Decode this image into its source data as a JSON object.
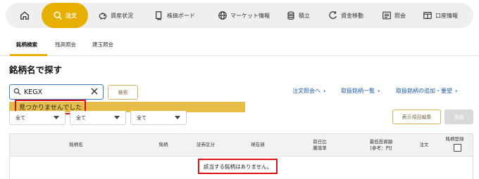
{
  "nav": {
    "items": [
      {
        "icon": "home-icon",
        "label": ""
      },
      {
        "icon": "search-icon",
        "label": "注文"
      },
      {
        "icon": "piggy-bank-icon",
        "label": "資産状況"
      },
      {
        "icon": "board-icon",
        "label": "株価ボード"
      },
      {
        "icon": "globe-icon",
        "label": "マーケット情報"
      },
      {
        "icon": "stack-icon",
        "label": "積立"
      },
      {
        "icon": "transfer-icon",
        "label": "資金移動"
      },
      {
        "icon": "inquiry-icon",
        "label": "照会"
      },
      {
        "icon": "account-icon",
        "label": "口座情報"
      }
    ],
    "active_color": "#e7b000"
  },
  "subtabs": [
    "銘柄検索",
    "残高照会",
    "建玉照会"
  ],
  "page_title": "銘柄名で探す",
  "search": {
    "value": "KEGX",
    "button": "検索"
  },
  "not_found": "見つかりませんでした",
  "links": [
    "注文照会へ",
    "取扱銘柄一覧",
    "取扱銘柄の追加・要望"
  ],
  "filters": [
    "全て",
    "全て",
    "全て"
  ],
  "buttons": {
    "display_items": "表示項目編集",
    "register": "登録"
  },
  "table": {
    "columns": [
      "銘柄名",
      "銘柄",
      "証券区分",
      "現在値",
      "前日比\n騰落率",
      "最低投資額\n[参考：円]",
      "注文",
      "銘柄登録"
    ],
    "empty_message": "該当する銘柄はありません。"
  },
  "colors": {
    "accent": "#e7b000",
    "link": "#1a5aa6",
    "highlight": "#e01010"
  }
}
